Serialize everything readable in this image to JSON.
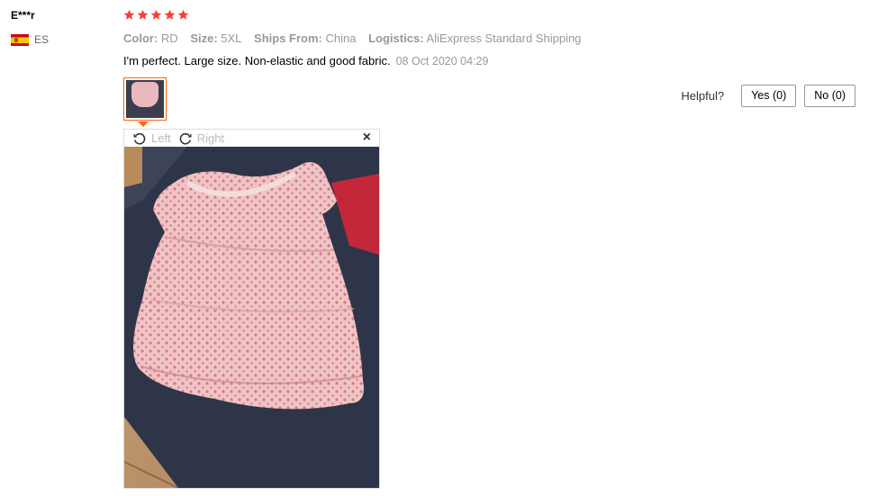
{
  "reviewer": {
    "name": "E***r",
    "country": "ES",
    "flag_icon": "spain-flag-icon"
  },
  "rating": {
    "stars": 5,
    "max": 5,
    "color": "#f44336"
  },
  "specs": [
    {
      "label": "Color:",
      "value": "RD"
    },
    {
      "label": "Size:",
      "value": "5XL"
    },
    {
      "label": "Ships From:",
      "value": "China"
    },
    {
      "label": "Logistics:",
      "value": "AliExpress Standard Shipping"
    }
  ],
  "review": {
    "text": "I'm perfect. Large size. Non-elastic and good fabric.",
    "date": "08 Oct 2020 04:29"
  },
  "helpful": {
    "label": "Helpful?",
    "yes": "Yes (0)",
    "no": "No (0)"
  },
  "viewer": {
    "rotate_left": "Left",
    "rotate_right": "Right",
    "close": "×"
  },
  "colors": {
    "accent": "#ff6600",
    "muted": "#999999"
  }
}
